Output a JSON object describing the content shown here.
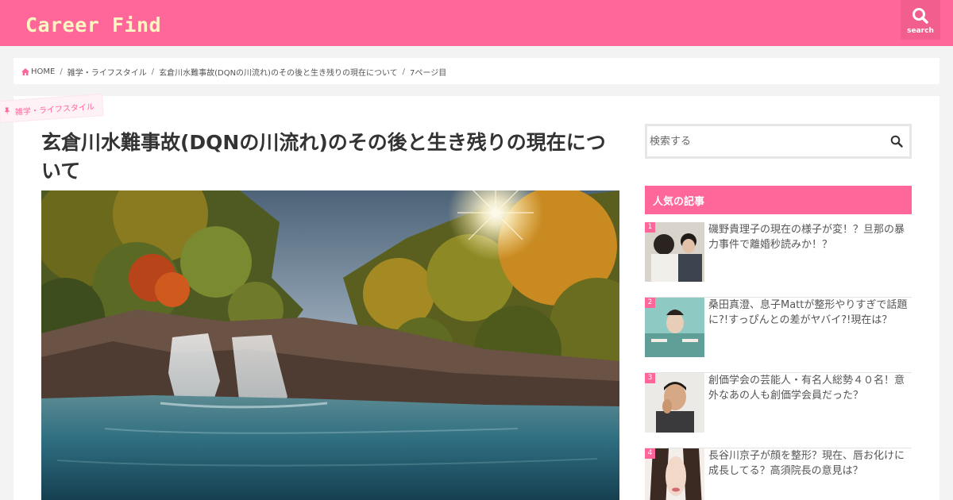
{
  "site": {
    "logo": "Career Find"
  },
  "header": {
    "search_label": "search"
  },
  "breadcrumb": {
    "home": "HOME",
    "category": "雑学・ライフスタイル",
    "post": "玄倉川水難事故(DQNの川流れ)のその後と生き残りの現在について",
    "page": "7ページ目"
  },
  "article": {
    "category_tag": "雑学・ライフスタイル",
    "title": "玄倉川水難事故(DQNの川流れ)のその後と生き残りの現在について"
  },
  "sidebar": {
    "search_placeholder": "検索する",
    "popular_heading": "人気の記事",
    "popular": [
      {
        "rank": "1",
        "title": "磯野貴理子の現在の様子が変！？旦那の暴力事件で離婚秒読みか！？"
      },
      {
        "rank": "2",
        "title": "桑田真澄、息子Mattが整形やりすぎで話題に?!すっぴんとの差がヤバイ?!現在は？"
      },
      {
        "rank": "3",
        "title": "創価学会の芸能人・有名人総勢４０名！意外なあの人も創価学会員だった？"
      },
      {
        "rank": "4",
        "title": "長谷川京子が顔を整形？現在、唇お化けに成長してる？高須院長の意見は？"
      }
    ]
  },
  "colors": {
    "accent": "#ff6699",
    "logo_text": "#fff7c2"
  },
  "icons": [
    "search-icon",
    "home-icon",
    "pin-icon"
  ]
}
